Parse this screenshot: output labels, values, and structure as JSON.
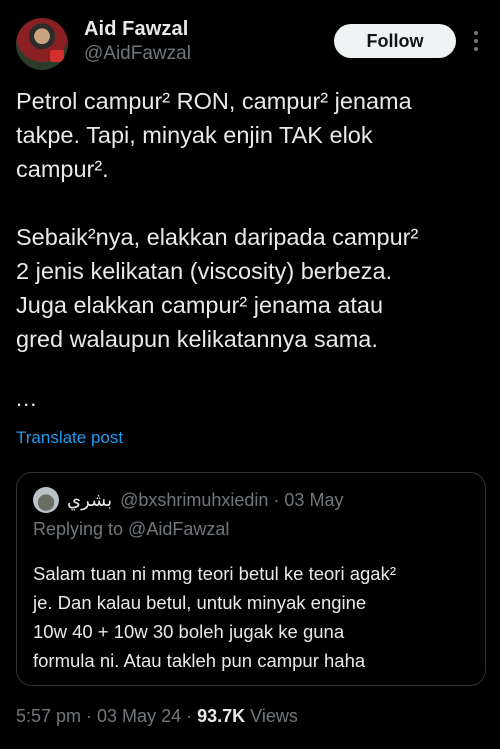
{
  "author": {
    "display_name": "Aid Fawzal",
    "handle": "@AidFawzal",
    "avatar_icon": "profile-avatar-runner"
  },
  "follow_label": "Follow",
  "post": {
    "paragraphs": [
      [
        "Petrol campur² RON, campur² jenama",
        "takpe. Tapi, minyak enjin TAK elok",
        "campur²."
      ],
      [
        "Sebaik²nya, elakkan daripada campur²",
        "2 jenis kelikatan (viscosity) berbeza.",
        "Juga elakkan campur² jenama atau",
        "gred walaupun kelikatannya sama."
      ]
    ],
    "ellipsis": "...",
    "translate_label": "Translate post"
  },
  "quote": {
    "name": "بشري",
    "handle_date": "@bxshrimuhxiedin · 03 May",
    "replying_to": "Replying to @AidFawzal",
    "lines": [
      "Salam tuan ni mmg teori betul ke teori agak²",
      "je. Dan kalau betul, untuk minyak engine",
      "10w 40 + 10w 30 boleh jugak ke guna",
      "formula ni. Atau takleh pun campur haha"
    ]
  },
  "meta": {
    "time_date": "5:57 pm · 03 May 24 · ",
    "views_count": "93.7K",
    "views_label": " Views"
  },
  "colors": {
    "background": "#000000",
    "text": "#e7e9ea",
    "muted": "#71767b",
    "link": "#1d9bf0",
    "button_bg": "#eff3f4"
  }
}
